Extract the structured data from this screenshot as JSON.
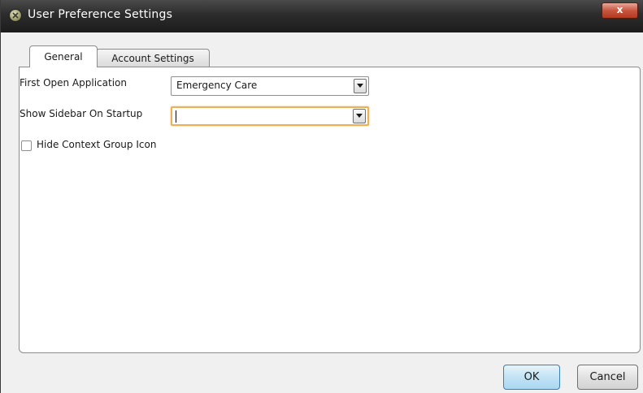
{
  "window": {
    "title": "User Preference Settings",
    "close_label": "x"
  },
  "tabs": [
    {
      "label": "General",
      "active": true
    },
    {
      "label": "Account Settings",
      "active": false
    }
  ],
  "general": {
    "first_open_label": "First Open Application",
    "first_open_value": "Emergency Care",
    "sidebar_label": "Show Sidebar On Startup",
    "sidebar_value": "",
    "hide_icon_label": "Hide Context Group Icon",
    "hide_icon_checked": false
  },
  "buttons": {
    "ok": "OK",
    "cancel": "Cancel"
  },
  "colors": {
    "focus_border": "#eab15a",
    "ok_button": "#c2e3f5"
  }
}
